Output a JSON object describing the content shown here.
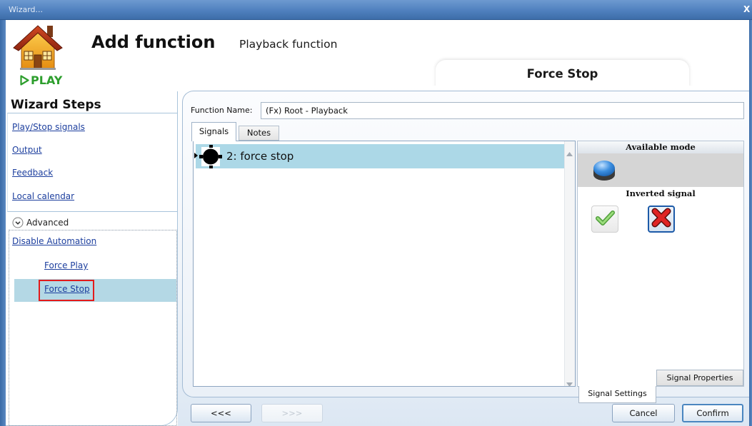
{
  "window": {
    "title": "Wizard...",
    "close_label": "X"
  },
  "header": {
    "logo_text": "PLAY",
    "title": "Add function",
    "subtitle": "Playback function",
    "step_title": "Force Stop"
  },
  "sidebar": {
    "heading": "Wizard Steps",
    "items": [
      {
        "label": "Play/Stop signals"
      },
      {
        "label": "Output"
      },
      {
        "label": "Feedback"
      },
      {
        "label": "Local calendar"
      }
    ],
    "advanced": {
      "label": "Advanced",
      "expanded": true,
      "items": [
        {
          "label": "Disable Automation",
          "selected": false
        },
        {
          "label": "Force Play",
          "selected": false
        },
        {
          "label": "Force Stop",
          "selected": true
        }
      ]
    }
  },
  "form": {
    "function_name_label": "Function Name:",
    "function_name_value": "(Fx) Root - Playback"
  },
  "tabs": [
    {
      "label": "Signals",
      "active": true
    },
    {
      "label": "Notes",
      "active": false
    }
  ],
  "signals": [
    {
      "label": "2: force stop",
      "selected": true,
      "icon": "signal-input-icon"
    }
  ],
  "settings": {
    "available_mode_label": "Available mode",
    "available_mode_icon": "push-button-icon",
    "inverted_signal_label": "Inverted signal",
    "inverted": true,
    "option_icons": [
      "check-icon",
      "cross-icon"
    ],
    "tabs": [
      {
        "label": "Signal Settings",
        "active": true
      },
      {
        "label": "Signal Properties",
        "active": false
      }
    ]
  },
  "buttons": {
    "back": "<<<",
    "next": ">>>",
    "next_enabled": false,
    "cancel": "Cancel",
    "confirm": "Confirm"
  },
  "colors": {
    "title_bar": "#4f80be",
    "link": "#1d3f9e",
    "selected_row": "#acd8e7",
    "sidebar_selected": "#b4d8e5",
    "highlight_outline": "#e31b1b",
    "accent_border": "#4a86c0"
  }
}
